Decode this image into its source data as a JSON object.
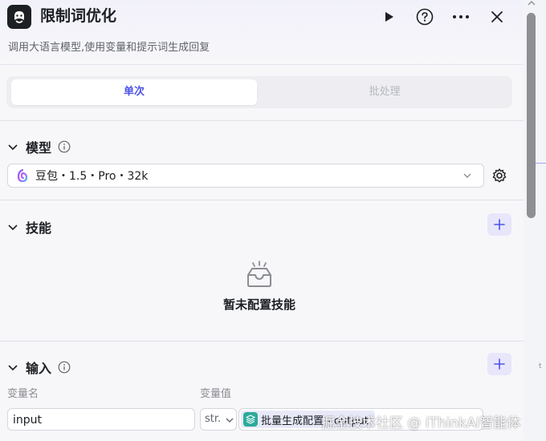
{
  "node": {
    "title": "限制词优化",
    "description": "调用大语言模型,使用变量和提示词生成回复"
  },
  "tabs": [
    {
      "label": "单次",
      "active": true
    },
    {
      "label": "批处理",
      "active": false
    }
  ],
  "model_section": {
    "title": "模型",
    "selected": "豆包・1.5・Pro・32k"
  },
  "skills_section": {
    "title": "技能",
    "empty_text": "暂未配置技能"
  },
  "input_section": {
    "title": "输入",
    "col_name": "变量名",
    "col_value": "变量值",
    "rows": [
      {
        "name": "input",
        "type": "str.",
        "value": "批量生成配置 - output"
      }
    ]
  },
  "watermark": "掘金技术社区 @ iThinkAi智能体",
  "edge_text": "t",
  "colors": {
    "accent": "#4d53e8",
    "plus_bg": "#e7e6fb",
    "chip_icon": "#2bab9a"
  }
}
